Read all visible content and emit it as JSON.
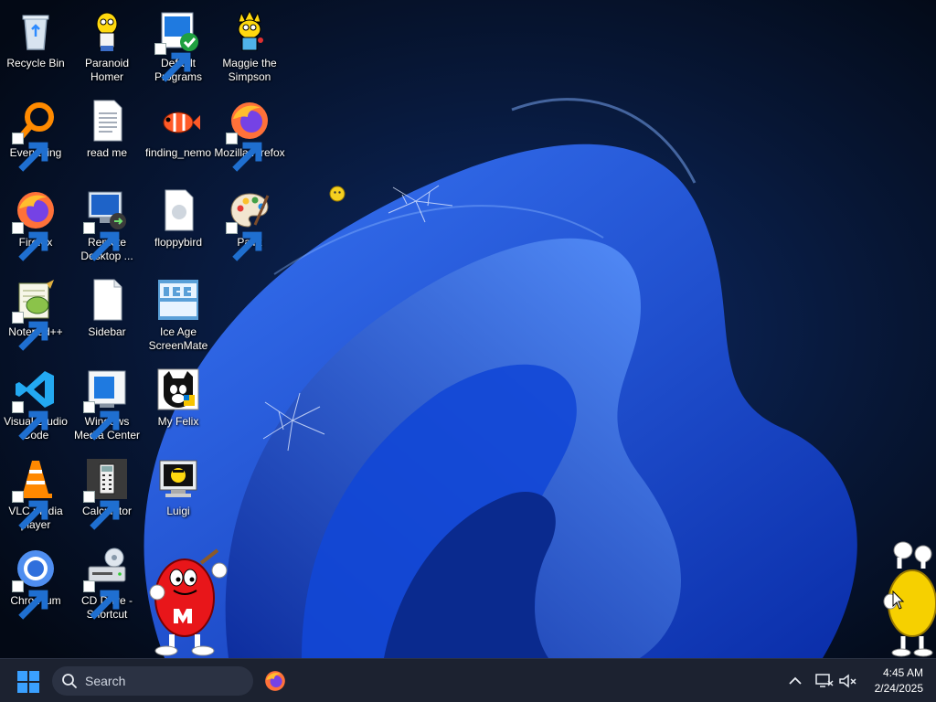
{
  "desktop": {
    "icons": [
      {
        "label": "Recycle Bin"
      },
      {
        "label": "Paranoid Homer"
      },
      {
        "label": "Default Programs"
      },
      {
        "label": "Maggie the Simpson"
      },
      {
        "label": "Everything"
      },
      {
        "label": "read me"
      },
      {
        "label": "finding_nemo"
      },
      {
        "label": "Mozilla Firefox"
      },
      {
        "label": "Firefox"
      },
      {
        "label": "Remote Desktop ..."
      },
      {
        "label": "floppybird"
      },
      {
        "label": "Paint"
      },
      {
        "label": "Notepad++"
      },
      {
        "label": "Sidebar"
      },
      {
        "label": "Ice Age ScreenMate"
      },
      {
        "label": "Visual Studio Code"
      },
      {
        "label": "Windows Media Center"
      },
      {
        "label": "My Felix"
      },
      {
        "label": "VLC media player"
      },
      {
        "label": "Calculator"
      },
      {
        "label": "Luigi"
      },
      {
        "label": "Chromium"
      },
      {
        "label": "CD Drive - Shortcut"
      }
    ]
  },
  "taskbar": {
    "search_placeholder": "Search",
    "clock": {
      "time": "4:45 AM",
      "date": "2/24/2025"
    }
  },
  "colors": {
    "taskbar_bg": "#1c2230",
    "search_bg": "#2b3243",
    "start_blue": "#3aa0ff",
    "wallpaper_blue": "#1e5cff"
  }
}
